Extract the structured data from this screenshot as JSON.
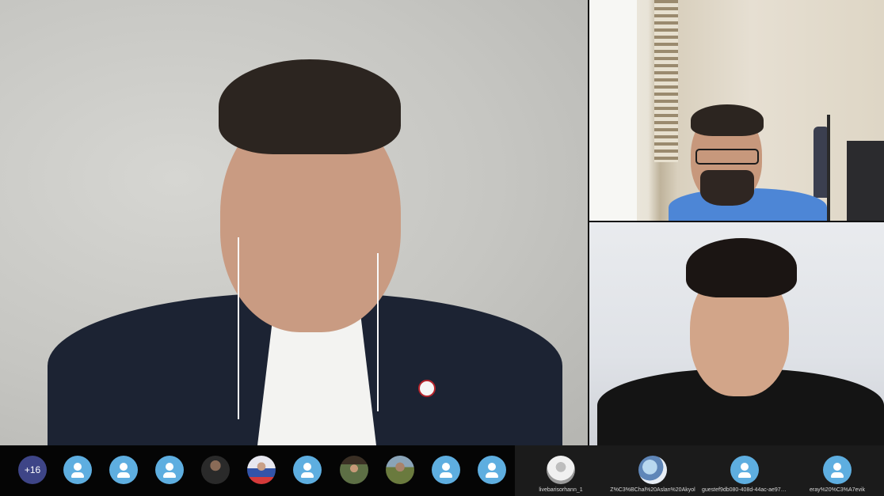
{
  "overflow_badge": "+16",
  "strip_participants": [
    {
      "id": "p1",
      "avatar": "user-icon"
    },
    {
      "id": "p2",
      "avatar": "user-icon"
    },
    {
      "id": "p3",
      "avatar": "user-icon"
    },
    {
      "id": "p4",
      "avatar": "photo"
    },
    {
      "id": "p5",
      "avatar": "photo"
    },
    {
      "id": "p6",
      "avatar": "user-icon"
    },
    {
      "id": "p7",
      "avatar": "photo"
    },
    {
      "id": "p8",
      "avatar": "photo"
    },
    {
      "id": "p9",
      "avatar": "user-icon"
    },
    {
      "id": "p10",
      "avatar": "user-icon"
    }
  ],
  "named_participants": [
    {
      "name": "livebarisorhann_1",
      "avatar": "photo"
    },
    {
      "name": "Z%C3%BChal%20Aslan%20Akyol",
      "avatar": "photo"
    },
    {
      "name": "guestef9db080-408d-44ac-ae97-6...",
      "avatar": "user-icon"
    },
    {
      "name": "eray%20%C3%A7evik",
      "avatar": "user-icon"
    }
  ],
  "colors": {
    "overflow_badge_bg": "#3e4587",
    "default_avatar_bg": "#5eaee0",
    "strip_bg": "#050505",
    "strip_named_bg": "#1b1b1b"
  }
}
